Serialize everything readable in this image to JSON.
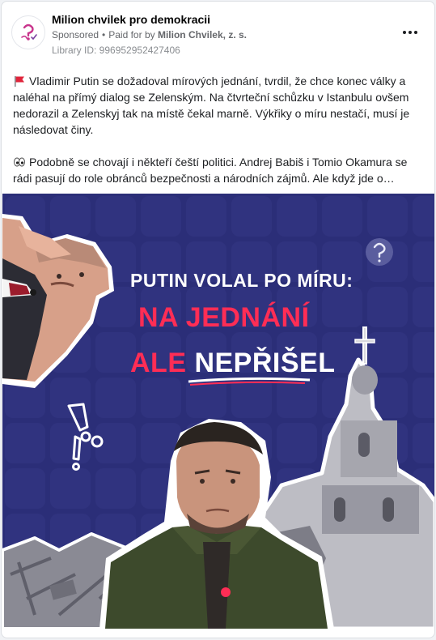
{
  "post": {
    "page_name": "Milion chvilek pro demokracii",
    "sponsored_label": "Sponsored",
    "bullet": "•",
    "paid_for_prefix": "Paid for by",
    "payer": "Milion Chvilek, z. s.",
    "library_id": "Library ID: 996952952427406",
    "menu_icon": "more-horizontal-icon",
    "paragraphs": [
      {
        "emoji": "red-flag-icon",
        "text": "Vladimir Putin se dožadoval mírových jednání, tvrdil, že chce konec války a naléhal na přímý dialog se Zelenským. Na čtvrteční schůzku v Istanbulu ovšem nedorazil a Zelenskyj tak na místě čekal marně. Výkřiky o míru nestačí, musí je následovat činy."
      },
      {
        "emoji": "eyes-icon",
        "text": "Podobně se chovají i někteří čeští politici. Andrej Babiš i Tomio Okamura se rádi pasují do role obránců bezpečnosti a národních zájmů. Ale když jde o…"
      }
    ]
  },
  "image": {
    "headline_1": "PUTIN VOLAL PO MÍRU:",
    "headline_2": "NA JEDNÁNÍ",
    "headline_3_word1": "ALE",
    "headline_3_word2": "NEPŘIŠEL",
    "background_color": "#2b2e78",
    "accent_color": "#ff2d55"
  }
}
